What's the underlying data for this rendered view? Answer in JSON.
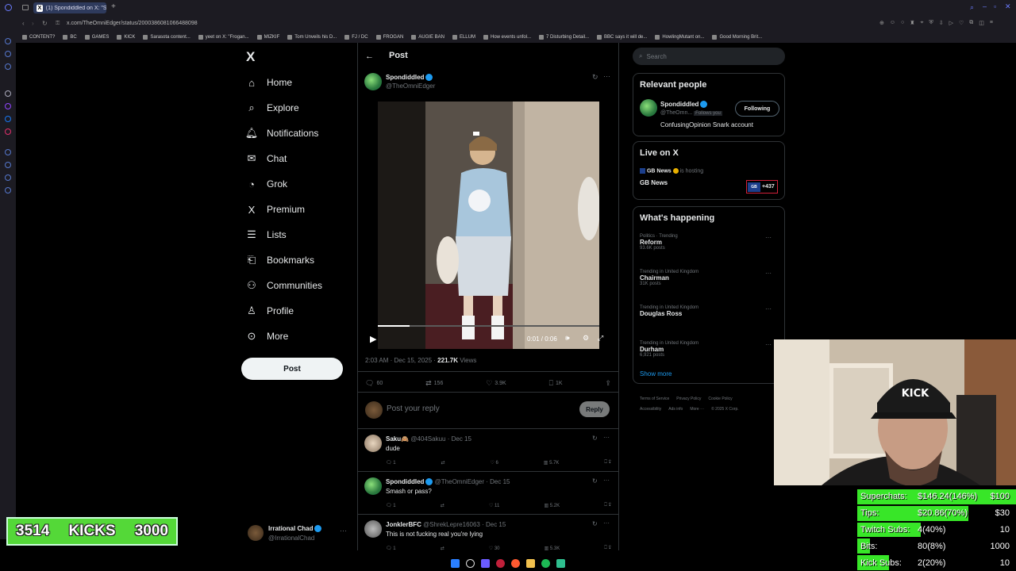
{
  "browser": {
    "tab_title": "(1) Spondiddled on X: \"Sm...",
    "url": "x.com/TheOmniEdger/status/2000386081066488098",
    "new_tab_icon": "plus-icon",
    "bookmarks": [
      "CONTENT?",
      "BC",
      "GAMES",
      "KICK",
      "Sarasota content...",
      "yeet on X: \"Frogan...",
      "MIZKIF",
      "Tom Unveils his D...",
      "FJ / DC",
      "FROGAN",
      "AUGIE BAN",
      "ELLUM",
      "How events unfol...",
      "7 Disturbing Detail...",
      "BBC says it will de...",
      "HowlingMutant on...",
      "Good Morning Brit..."
    ]
  },
  "nav": {
    "logo": "X",
    "items": [
      {
        "label": "Home",
        "icon": "home-icon"
      },
      {
        "label": "Explore",
        "icon": "search-icon"
      },
      {
        "label": "Notifications",
        "icon": "bell-icon"
      },
      {
        "label": "Chat",
        "icon": "mail-icon"
      },
      {
        "label": "Grok",
        "icon": "grok-icon"
      },
      {
        "label": "Premium",
        "icon": "x-icon"
      },
      {
        "label": "Lists",
        "icon": "list-icon"
      },
      {
        "label": "Bookmarks",
        "icon": "bookmark-icon"
      },
      {
        "label": "Communities",
        "icon": "people-icon"
      },
      {
        "label": "Profile",
        "icon": "person-icon"
      },
      {
        "label": "More",
        "icon": "more-circle-icon"
      }
    ],
    "post_button": "Post",
    "account": {
      "name": "Irrational Chad",
      "handle": "@IrrationalChad"
    }
  },
  "post": {
    "header_title": "Post",
    "author_name": "Spondiddled",
    "author_handle": "@TheOmniEdger",
    "video_time": "0:01 / 0:06",
    "video_progress": 0.17,
    "timestamp": "2:03 AM · Dec 15, 2025 ·",
    "views_count": "221.7K",
    "views_label": "Views",
    "replies": "60",
    "reposts": "156",
    "likes": "3.9K",
    "bookmarks": "1K",
    "reply_placeholder": "Post your reply",
    "reply_button": "Reply"
  },
  "replies": [
    {
      "name": "Saku🙈",
      "handle": "@404Sakuu · Dec 15",
      "text": "dude",
      "replies": "1",
      "reposts": "",
      "likes": "6",
      "views": "5.7K"
    },
    {
      "name": "Spondiddled",
      "handle": "@TheOmniEdger · Dec 15",
      "text": "Smash or pass?",
      "replies": "1",
      "reposts": "",
      "likes": "11",
      "views": "5.2K"
    },
    {
      "name": "JonklerBFC",
      "handle": "@ShrekLepre16063 · Dec 15",
      "text": "This is not fucking real you're lying",
      "replies": "1",
      "reposts": "",
      "likes": "30",
      "views": "5.3K"
    }
  ],
  "sidebar": {
    "search_placeholder": "Search",
    "relevant_title": "Relevant people",
    "relevant_name": "Spondiddled",
    "relevant_handle": "@TheOmn...",
    "follows_you": "Follows you",
    "following_button": "Following",
    "relevant_bio": "ConfusingOpinion Snark account",
    "live_title": "Live on X",
    "live_host": "GB News",
    "live_status": "is hosting",
    "live_name": "GB News",
    "live_count": "+437",
    "happening_title": "What's happening",
    "trends": [
      {
        "category": "Politics · Trending",
        "name": "Reform",
        "count": "93.6K posts"
      },
      {
        "category": "Trending in United Kingdom",
        "name": "Chairman",
        "count": "31K posts"
      },
      {
        "category": "Trending in United Kingdom",
        "name": "Douglas Ross",
        "count": ""
      },
      {
        "category": "Trending in United Kingdom",
        "name": "Durham",
        "count": "6,921 posts"
      }
    ],
    "show_more": "Show more",
    "footer": [
      "Terms of Service",
      "Privacy Policy",
      "Cookie Policy",
      "Accessibility",
      "Ads info",
      "More ···",
      "© 2025 X Corp."
    ]
  },
  "overlay": {
    "kicks_current": "3514",
    "kicks_label": "KICKS",
    "kicks_goal": "3000",
    "stats": [
      {
        "label": "Superchats:",
        "value": "$146.24(146%)",
        "goal": "$100",
        "fill": 1.0
      },
      {
        "label": "Tips:",
        "value": "$20.86(70%)",
        "goal": "$30",
        "fill": 0.7
      },
      {
        "label": "Twitch Subs:",
        "value": "4(40%)",
        "goal": "10",
        "fill": 0.4
      },
      {
        "label": "Bits:",
        "value": "80(8%)",
        "goal": "1000",
        "fill": 0.08
      },
      {
        "label": "Kick Subs:",
        "value": "2(20%)",
        "goal": "10",
        "fill": 0.2
      }
    ],
    "cap_text": "KICK"
  }
}
